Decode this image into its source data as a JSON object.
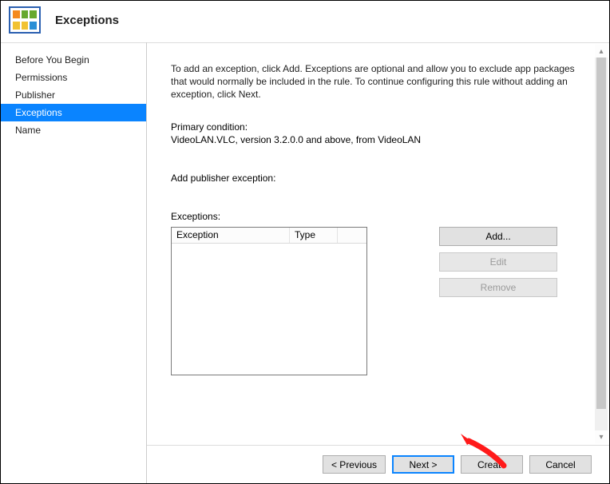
{
  "header": {
    "title": "Exceptions"
  },
  "sidebar": {
    "items": [
      {
        "label": "Before You Begin",
        "selected": false
      },
      {
        "label": "Permissions",
        "selected": false
      },
      {
        "label": "Publisher",
        "selected": false
      },
      {
        "label": "Exceptions",
        "selected": true
      },
      {
        "label": "Name",
        "selected": false
      }
    ]
  },
  "content": {
    "intro": "To add an exception, click Add. Exceptions are optional and allow you to exclude app packages that would normally be included in the rule. To continue configuring this rule without adding an exception, click Next.",
    "primary_label": "Primary condition:",
    "primary_value": "VideoLAN.VLC, version 3.2.0.0 and above, from VideoLAN",
    "add_publisher_label": "Add publisher exception:",
    "exceptions_label": "Exceptions:",
    "columns": {
      "exception": "Exception",
      "type": "Type"
    },
    "buttons": {
      "add": "Add...",
      "edit": "Edit",
      "remove": "Remove"
    }
  },
  "footer": {
    "previous": "< Previous",
    "next": "Next >",
    "create": "Create",
    "cancel": "Cancel"
  }
}
